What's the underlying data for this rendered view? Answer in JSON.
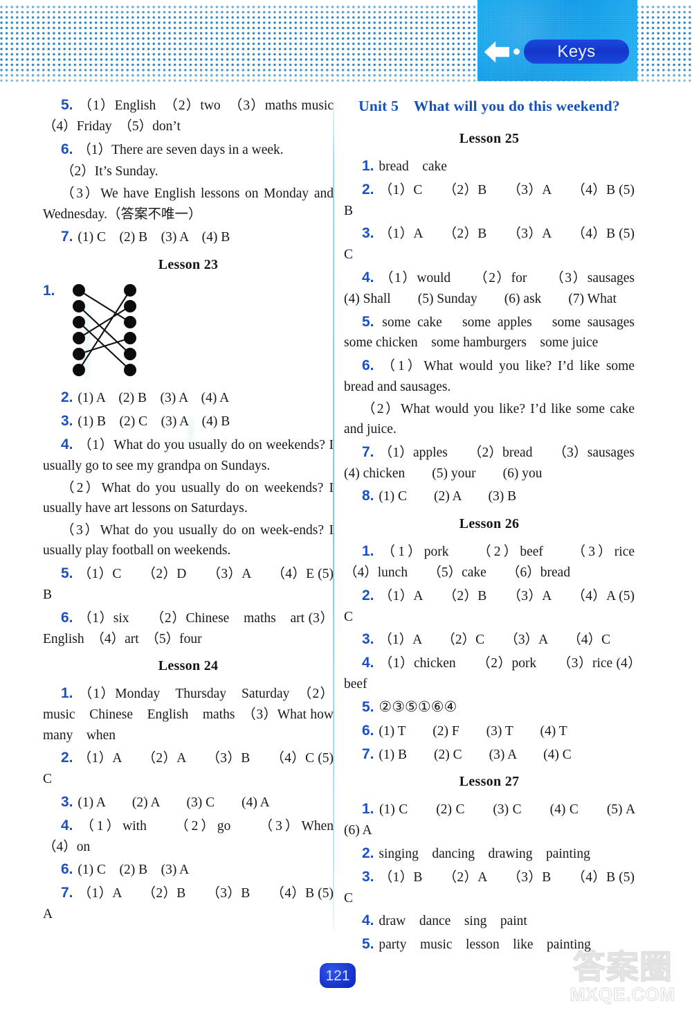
{
  "header": {
    "keys_label": "Keys",
    "back_icon": "left-arrow-icon",
    "accent_cyan": "#0fa8f0",
    "accent_blue": "#1536c9"
  },
  "footer": {
    "page_number": "121",
    "watermark_cn": "答案圈",
    "watermark_domain": "MXQE.COM"
  },
  "left_column": {
    "items": [
      {
        "type": "para",
        "num": "5.",
        "text": "（1）English　（2）two　（3）maths music　（4）Friday　（5）don’t"
      },
      {
        "type": "para",
        "num": "6.",
        "text": "（1）There are seven days in a week."
      },
      {
        "type": "para",
        "num": "",
        "text": "（2）It’s Sunday."
      },
      {
        "type": "para",
        "num": "",
        "text": "（3）We have English lessons on Monday and Wednesday.（答案不唯一）"
      },
      {
        "type": "para",
        "num": "7.",
        "text": "(1) C　(2) B　(3) A　(4) B"
      },
      {
        "type": "lesson",
        "text": "Lesson 23"
      },
      {
        "type": "match",
        "num": "1."
      },
      {
        "type": "para",
        "num": "2.",
        "text": "(1) A　(2) B　(3) A　(4) A"
      },
      {
        "type": "para",
        "num": "3.",
        "text": "(1) B　(2) C　(3) A　(4) B"
      },
      {
        "type": "para",
        "num": "4.",
        "text": "（1）What do you usually do on weekends? I usually go to see my grandpa on Sundays."
      },
      {
        "type": "para",
        "num": "",
        "text": "（2）What do you usually do on weekends? I usually have art lessons on Saturdays."
      },
      {
        "type": "para",
        "num": "",
        "text": "（3）What do you usually do on week-ends? I usually play football on weekends."
      },
      {
        "type": "para",
        "num": "5.",
        "text": "（1）C　　（2）D　　（3）A　　（4）E (5) B"
      },
      {
        "type": "para",
        "num": "6.",
        "text": "（1）six　　（2）Chinese　maths　art (3）English　（4）art　（5）four"
      },
      {
        "type": "lesson",
        "text": "Lesson 24"
      },
      {
        "type": "para",
        "num": "1.",
        "text": "（1）Monday　Thursday　Saturday　（2）music　Chinese　English　maths　（3）What how many　when"
      },
      {
        "type": "para",
        "num": "2.",
        "text": "（1）A　　（2）A　　（3）B　　（4）C (5) C"
      },
      {
        "type": "para",
        "num": "3.",
        "text": "(1) A　　(2) A　　(3) C　　(4) A"
      },
      {
        "type": "para",
        "num": "4.",
        "text": "（1）with　　（2）go　　（3）When　　（4）on"
      },
      {
        "type": "para",
        "num": "6.",
        "text": "(1) C　(2) B　(3) A"
      },
      {
        "type": "para",
        "num": "7.",
        "text": "（1）A　　（2）B　　（3）B　　（4）B (5) A"
      }
    ],
    "match_diagram": {
      "name": "match-lines-diagram",
      "left_nodes": 6,
      "right_nodes": 6,
      "connections": [
        [
          1,
          3
        ],
        [
          2,
          5
        ],
        [
          3,
          6
        ],
        [
          4,
          2
        ],
        [
          5,
          4
        ],
        [
          6,
          1
        ]
      ]
    }
  },
  "right_column": {
    "unit_title": "Unit 5　What will you do this weekend?",
    "items": [
      {
        "type": "lesson",
        "text": "Lesson 25"
      },
      {
        "type": "para",
        "num": "1.",
        "text": "bread　cake"
      },
      {
        "type": "para",
        "num": "2.",
        "text": "（1）C　　（2）B　　（3）A　　（4）B (5) B"
      },
      {
        "type": "para",
        "num": "3.",
        "text": "（1）A　　（2）B　　（3）A　　（4）B (5) C"
      },
      {
        "type": "para",
        "num": "4.",
        "text": "（1）would　　（2）for　　（3）sausages (4) Shall　　(5) Sunday　　(6) ask　　(7) What"
      },
      {
        "type": "para",
        "num": "5.",
        "text": "some cake　some apples　some sausages some chicken　some hamburgers　some juice"
      },
      {
        "type": "para",
        "num": "6.",
        "text": "（1）What would you like? I’d like some bread and sausages."
      },
      {
        "type": "para",
        "num": "",
        "text": "（2）What would you like? I’d like some cake and juice."
      },
      {
        "type": "para",
        "num": "7.",
        "text": "（1）apples　　（2）bread　　（3）sausages (4) chicken　　(5) your　　(6) you"
      },
      {
        "type": "para",
        "num": "8.",
        "text": "(1) C　　(2) A　　(3) B"
      },
      {
        "type": "lesson",
        "text": "Lesson 26"
      },
      {
        "type": "para",
        "num": "1.",
        "text": "（1）pork　　（2）beef　　（3）rice　　（4）lunch　　（5）cake　　（6）bread"
      },
      {
        "type": "para",
        "num": "2.",
        "text": "（1）A　　（2）B　　（3）A　　（4）A (5) C"
      },
      {
        "type": "para",
        "num": "3.",
        "text": "（1）A　　（2）C　　（3）A　　（4）C"
      },
      {
        "type": "para",
        "num": "4.",
        "text": "（1）chicken　　（2）pork　　（3）rice (4）beef"
      },
      {
        "type": "para",
        "num": "5.",
        "text": "②③⑤①⑥④",
        "circled": true
      },
      {
        "type": "para",
        "num": "6.",
        "text": "(1) T　　(2) F　　(3) T　　(4) T"
      },
      {
        "type": "para",
        "num": "7.",
        "text": "(1) B　　(2) C　　(3) A　　(4) C"
      },
      {
        "type": "lesson",
        "text": "Lesson 27"
      },
      {
        "type": "para",
        "num": "1.",
        "text": "(1) C　　(2) C　　(3) C　　(4) C　　(5) A　　(6) A"
      },
      {
        "type": "para",
        "num": "2.",
        "text": "singing　dancing　drawing　painting"
      },
      {
        "type": "para",
        "num": "3.",
        "text": "（1）B　　（2）A　　（3）B　　（4）B (5) C"
      },
      {
        "type": "para",
        "num": "4.",
        "text": "draw　dance　sing　paint"
      },
      {
        "type": "para",
        "num": "5.",
        "text": "party　music　lesson　like　painting"
      }
    ]
  }
}
